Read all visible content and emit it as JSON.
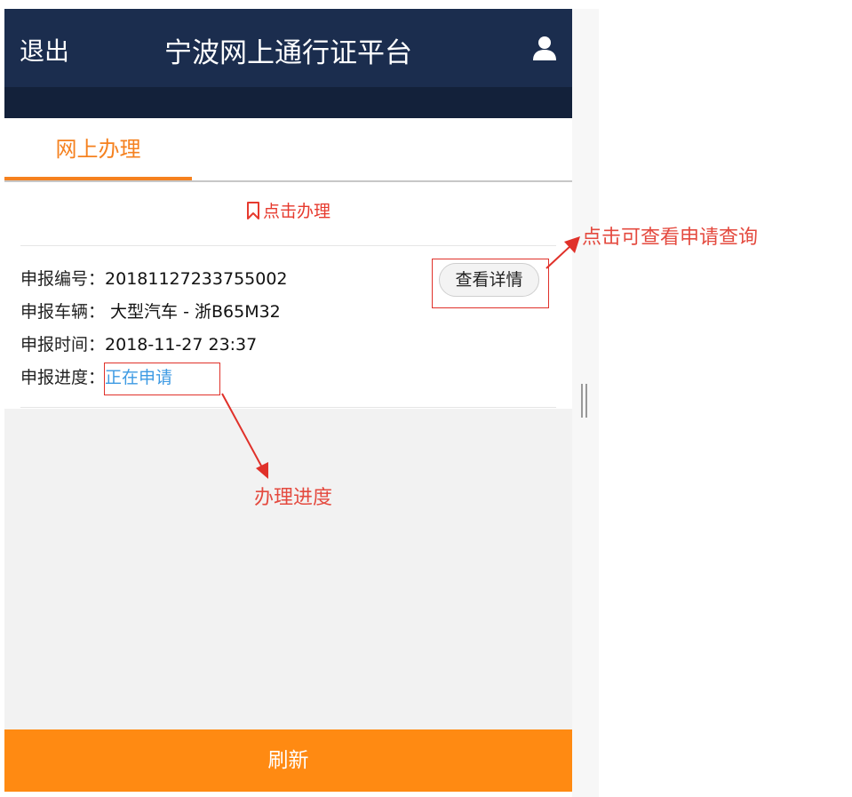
{
  "header": {
    "logout_label": "退出",
    "title": "宁波网上通行证平台",
    "user_icon": "user-icon"
  },
  "tabs": [
    {
      "label": "网上办理",
      "active": true
    }
  ],
  "card": {
    "action_label": "点击办理",
    "action_icon": "bookmark-icon",
    "detail_button_label": "查看详情",
    "fields": [
      {
        "label": "申报编号：",
        "value": "20181127233755002"
      },
      {
        "label": "申报车辆：",
        "value": " 大型汽车 - 浙B65M32"
      },
      {
        "label": "申报时间：",
        "value": "2018-11-27 23:37"
      },
      {
        "label": "申报进度：",
        "value": "正在申请"
      }
    ]
  },
  "footer": {
    "refresh_label": "刷新"
  },
  "annotations": {
    "view_details_note": "点击可查看申请查询",
    "progress_note": "办理进度"
  },
  "colors": {
    "header_bg": "#1b2d4e",
    "accent_orange": "#f5811f",
    "refresh_bg": "#ff8a12",
    "status_blue": "#3d9ae3",
    "annotation_red": "#e0312a"
  }
}
